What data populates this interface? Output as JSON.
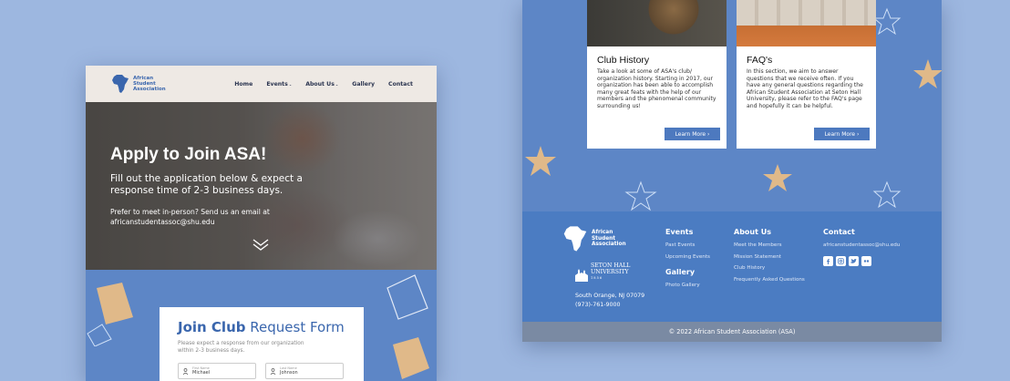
{
  "left_page": {
    "nav": {
      "logo_text": "African Student Association",
      "links": [
        {
          "label": "Home",
          "dropdown": false
        },
        {
          "label": "Events",
          "dropdown": true
        },
        {
          "label": "About Us",
          "dropdown": true
        },
        {
          "label": "Gallery",
          "dropdown": false
        },
        {
          "label": "Contact",
          "dropdown": false
        }
      ]
    },
    "hero": {
      "title": "Apply to Join ASA!",
      "subtitle": "Fill out the application below & expect a response time of 2-3 business days.",
      "note": "Prefer to meet in-person? Send us an email at africanstudentassoc@shu.edu",
      "scroll_icon": "double-chevron-down-icon"
    },
    "form": {
      "title_bold": "Join Club",
      "title_rest": " Request Form",
      "description": "Please expect a response from our organization within 2-3 business days.",
      "fields": [
        {
          "placeholder": "First Name",
          "value": "Michael",
          "icon": "person-icon"
        },
        {
          "placeholder": "Last Name",
          "value": "Johnson",
          "icon": "person-icon"
        }
      ]
    }
  },
  "right_page": {
    "cards": [
      {
        "title": "Club History",
        "text": "Take a look at some of ASA's club/ organization history. Starting in 2017, our organization has been able to accomplish many great feats with the help of our members and the phenomenal community surrounding us!",
        "button": "Learn More ›"
      },
      {
        "title": "FAQ's",
        "text": "In this section, we aim to answer questions that we receive often. If you have any general questions regarding the African Student Association at Seton Hall University, please refer to the FAQ's page and hopefully it can be helpful.",
        "button": "Learn More ›"
      }
    ],
    "footer": {
      "logo_text": "African Student Association",
      "university": "SETON HALL UNIVERSITY",
      "university_est": "1856",
      "address_line1": "South Orange, NJ 07079",
      "address_line2": "(973)-761-9000",
      "columns": [
        {
          "heading": "Events",
          "links": [
            "Past Events",
            "Upcoming Events"
          ]
        },
        {
          "heading": "Gallery",
          "links": [
            "Photo Gallery"
          ]
        },
        {
          "heading": "About Us",
          "links": [
            "Meet the Members",
            "Mission Statement",
            "Club History",
            "Frequently Asked Questions"
          ]
        },
        {
          "heading": "Contact",
          "links": [
            "africanstudentassoc@shu.edu"
          ]
        }
      ],
      "socials": [
        "facebook-icon",
        "instagram-icon",
        "twitter-icon",
        "flickr-icon"
      ],
      "copyright": "© 2022 African Student Association (ASA)"
    }
  },
  "colors": {
    "background": "#9db7e0",
    "page_blue": "#5d86c6",
    "footer_blue": "#4b7cc2",
    "accent": "#3a66ad",
    "deco_tan": "#e0b989"
  }
}
